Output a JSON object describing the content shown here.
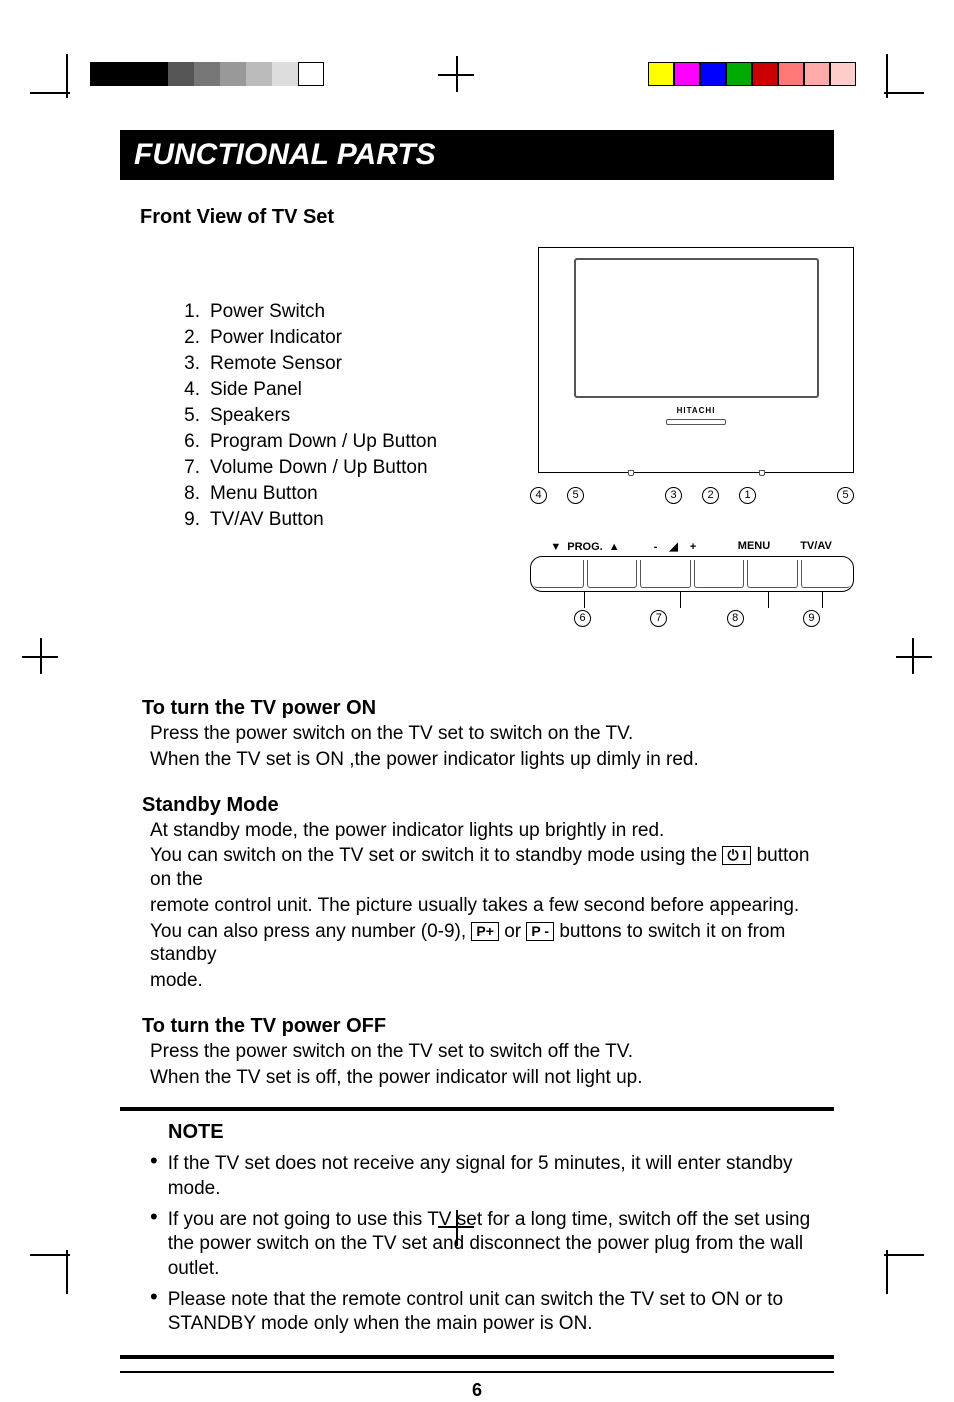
{
  "page_title": "FUNCTIONAL PARTS",
  "subtitle": "Front View of TV Set",
  "parts_list": [
    {
      "n": "1.",
      "label": "Power Switch"
    },
    {
      "n": "2.",
      "label": "Power Indicator"
    },
    {
      "n": "3.",
      "label": "Remote Sensor"
    },
    {
      "n": "4.",
      "label": "Side Panel"
    },
    {
      "n": "5.",
      "label": "Speakers"
    },
    {
      "n": "6.",
      "label": "Program Down / Up Button"
    },
    {
      "n": "7.",
      "label": "Volume Down / Up Button"
    },
    {
      "n": "8.",
      "label": "Menu Button"
    },
    {
      "n": "9.",
      "label": "TV/AV Button"
    }
  ],
  "diagram": {
    "brand": "HITACHI",
    "callouts_top": [
      "4",
      "5",
      "3",
      "2",
      "1",
      "5"
    ],
    "panel_labels": {
      "prog": "PROG.",
      "minus": "-",
      "plus": "+",
      "menu": "MENU",
      "tvav": "TV/AV"
    },
    "callouts_bottom": [
      "6",
      "7",
      "8",
      "9"
    ]
  },
  "sections": {
    "power_on": {
      "heading": "To turn the TV power ON",
      "l1": "Press the power switch on the TV set to switch on the TV.",
      "l2": "When the TV set is ON ,the power indicator lights up dimly in red."
    },
    "standby": {
      "heading": "Standby Mode",
      "l1": "At standby mode, the power indicator lights up brightly in red.",
      "l2a": "You can switch on the TV set or switch it to standby mode using the",
      "l2b": "button on the",
      "l3": "remote control unit. The picture usually takes a few second before appearing.",
      "l4a": "You can also press any number (0-9),",
      "l4b": "or",
      "l4c": "buttons to switch it on from standby",
      "l5": "mode.",
      "key_power": "⏻ I",
      "key_pplus": "P+",
      "key_pminus": "P -"
    },
    "power_off": {
      "heading": "To turn the TV power OFF",
      "l1": "Press the power switch on the TV set to switch off the TV.",
      "l2": "When the TV set is off, the power indicator will not light up."
    }
  },
  "note": {
    "heading": "NOTE",
    "items": [
      "If the TV set does not receive any signal for 5 minutes, it will enter standby mode.",
      "If you are not going to use this TV set for a long time, switch off the set using the power switch on the TV set and disconnect the power plug from the wall outlet.",
      "Please note that the remote control unit can switch the TV set to ON or to STANDBY mode only when the main power is ON."
    ]
  },
  "page_number": "6"
}
